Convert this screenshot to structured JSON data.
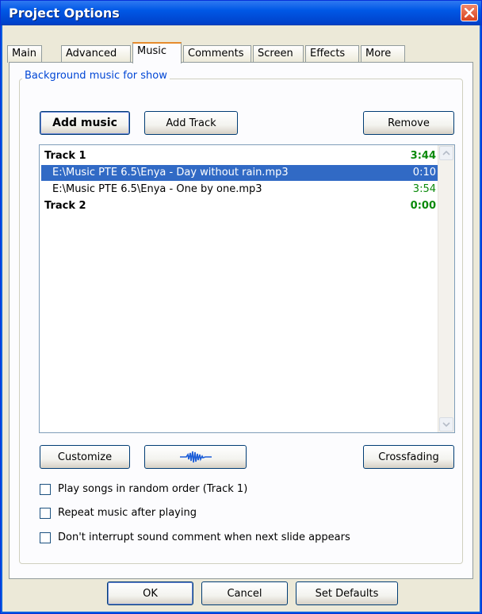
{
  "window": {
    "title": "Project Options"
  },
  "tabs": [
    {
      "label": "Main"
    },
    {
      "label": "Advanced"
    },
    {
      "label": "Music"
    },
    {
      "label": "Comments"
    },
    {
      "label": "Screen"
    },
    {
      "label": "Effects"
    },
    {
      "label": "More"
    }
  ],
  "music": {
    "group_label": "Background music for show",
    "add_music_label": "Add music",
    "add_track_label": "Add Track",
    "remove_label": "Remove",
    "rows": [
      {
        "type": "track",
        "name": "Track 1",
        "time": "3:44"
      },
      {
        "type": "file",
        "name": "E:\\Music PTE 6.5\\Enya - Day without rain.mp3",
        "time": "0:10",
        "selected": true
      },
      {
        "type": "file",
        "name": "E:\\Music PTE 6.5\\Enya - One by one.mp3",
        "time": "3:54"
      },
      {
        "type": "track",
        "name": "Track 2",
        "time": "0:00"
      }
    ],
    "customize_label": "Customize",
    "crossfading_label": "Crossfading",
    "options": [
      {
        "label": "Play songs in random order (Track 1)",
        "checked": false
      },
      {
        "label": "Repeat music after playing",
        "checked": false
      },
      {
        "label": "Don't interrupt sound comment when next slide appears",
        "checked": false
      }
    ]
  },
  "footer": {
    "ok_label": "OK",
    "cancel_label": "Cancel",
    "set_defaults_label": "Set Defaults"
  },
  "colors": {
    "title_bar": "#0058e6",
    "group_label": "#0046d5",
    "selection": "#316ac5",
    "duration_text": "#0a8a0a",
    "active_tab_accent": "#e68b2c"
  }
}
